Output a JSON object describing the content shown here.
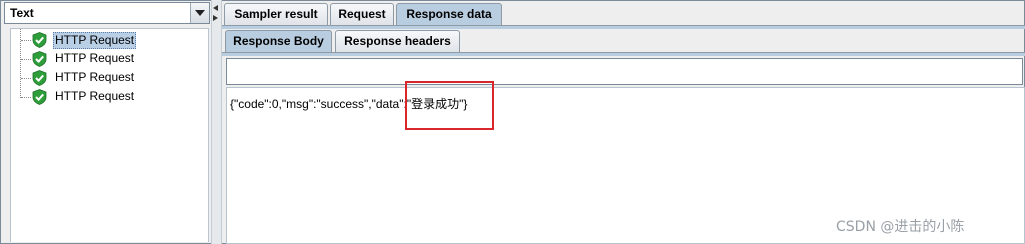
{
  "left_panel": {
    "renderer_select": {
      "value": "Text"
    },
    "tree": [
      {
        "label": "HTTP Request",
        "status": "success",
        "selected": true
      },
      {
        "label": "HTTP Request",
        "status": "success",
        "selected": false
      },
      {
        "label": "HTTP Request",
        "status": "success",
        "selected": false
      },
      {
        "label": "HTTP Request",
        "status": "success",
        "selected": false
      }
    ]
  },
  "result_tabs": [
    {
      "label": "Sampler result",
      "active": false
    },
    {
      "label": "Request",
      "active": false
    },
    {
      "label": "Response data",
      "active": true
    }
  ],
  "response_tabs": [
    {
      "label": "Response Body",
      "active": true
    },
    {
      "label": "Response headers",
      "active": false
    }
  ],
  "search": {
    "value": ""
  },
  "response_body": "{\"code\":0,\"msg\":\"success\",\"data\":\"登录成功\"}",
  "watermark": "CSDN @进击的小陈",
  "colors": {
    "active_tab": "#b9cde0",
    "success_icon": "#2e9e3a",
    "highlight": "#d8262b"
  }
}
